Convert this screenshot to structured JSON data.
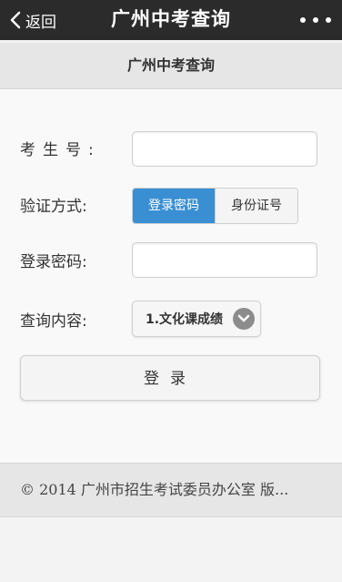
{
  "topbar": {
    "back_label": "返回",
    "title": "广州中考查询",
    "more_icon": "more-icon"
  },
  "subheader": {
    "title": "广州中考查询"
  },
  "form": {
    "exam_number_label": "考生号:",
    "exam_number_value": "",
    "auth_method_label": "验证方式:",
    "auth_options": [
      "登录密码",
      "身份证号"
    ],
    "auth_selected": "登录密码",
    "password_label": "登录密码:",
    "password_value": "",
    "query_label": "查询内容:",
    "query_selected": "1.文化课成绩",
    "login_button": "登录"
  },
  "footer": {
    "text": "© 2014 广州市招生考试委员办公室 版..."
  },
  "colors": {
    "topbar": "#2b2b2b",
    "accent": "#3a8fd2"
  }
}
